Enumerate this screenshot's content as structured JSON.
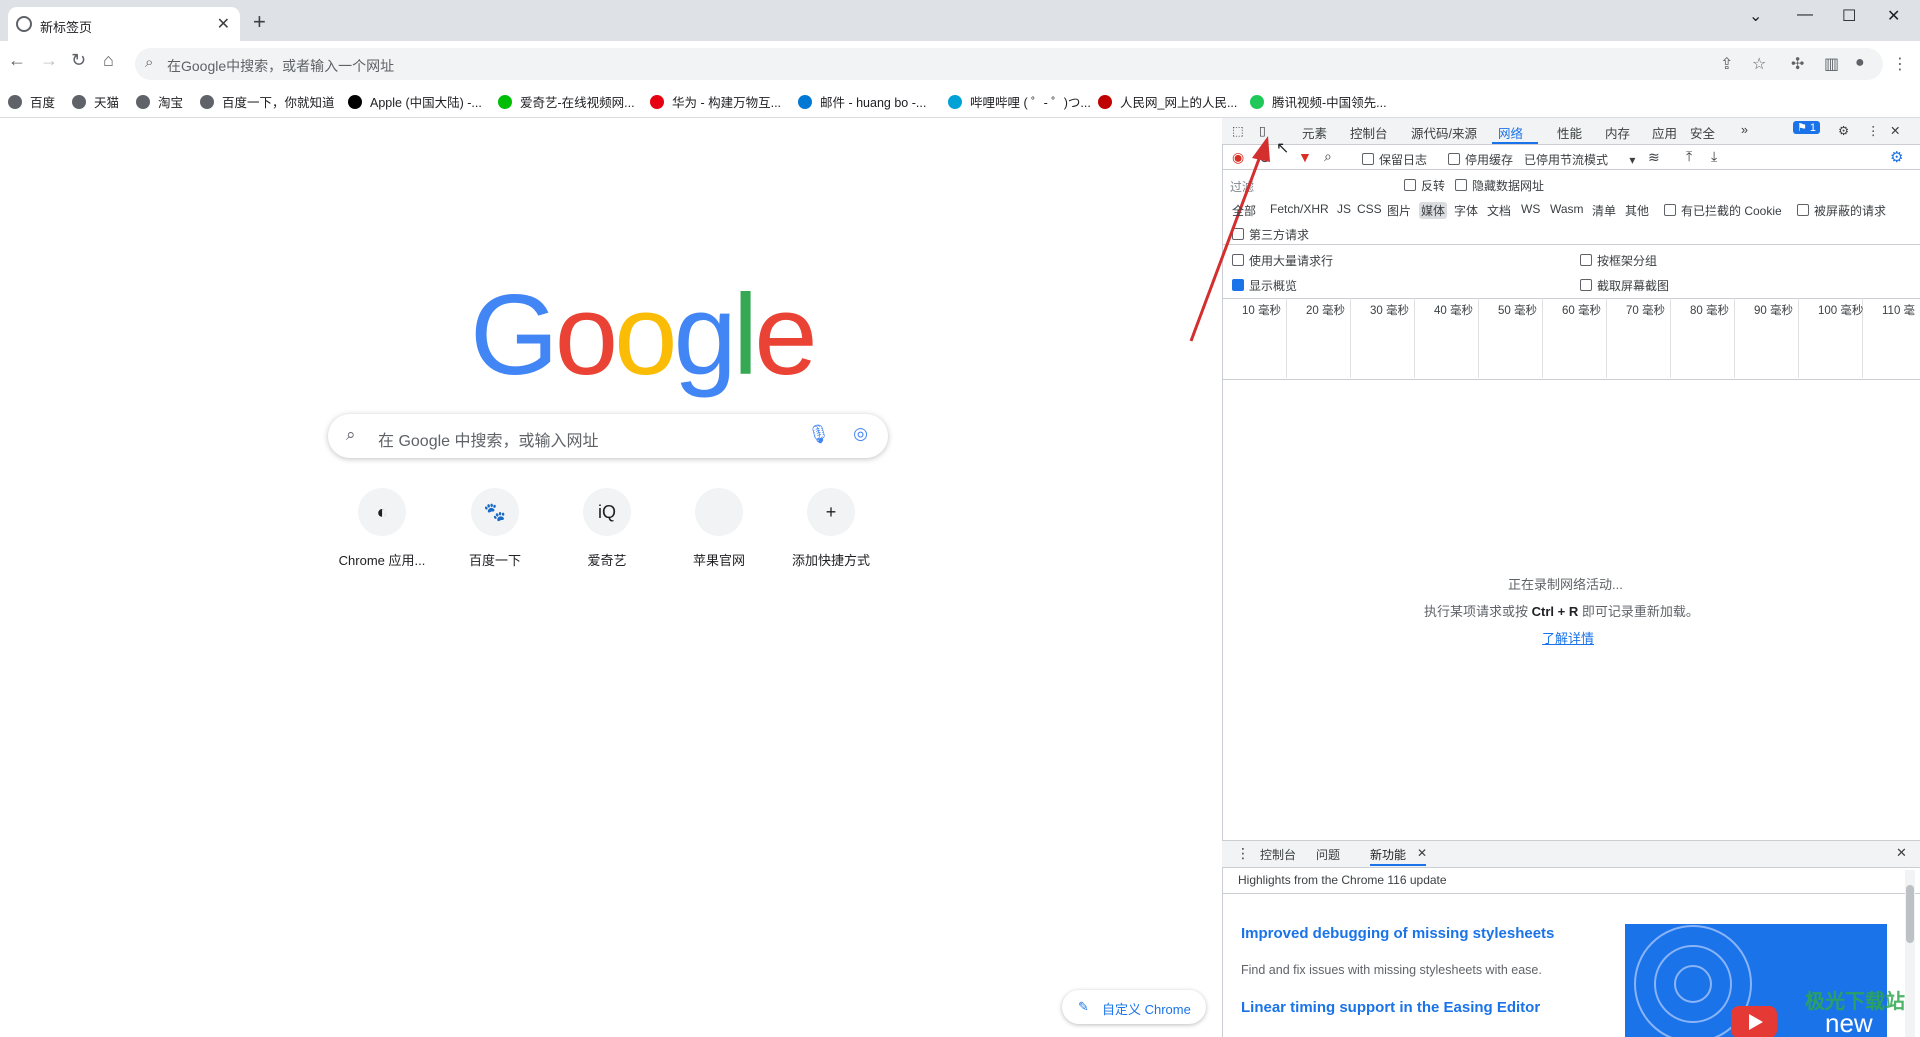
{
  "browser": {
    "tab_title": "新标签页",
    "tab_close": "✕",
    "new_tab": "+",
    "window_controls": [
      "⌄",
      "—",
      "☐",
      "✕"
    ],
    "omnibox_placeholder": "在Google中搜索，或者输入一个网址",
    "bookmarks": [
      {
        "label": "百度",
        "icon": "globe-icon",
        "color": "#5f6368"
      },
      {
        "label": "天猫",
        "icon": "globe-icon",
        "color": "#5f6368"
      },
      {
        "label": "淘宝",
        "icon": "globe-icon",
        "color": "#5f6368"
      },
      {
        "label": "百度一下，你就知道",
        "icon": "globe-icon",
        "color": "#5f6368"
      },
      {
        "label": "Apple (中国大陆) -...",
        "icon": "apple-icon",
        "color": "#000000"
      },
      {
        "label": "爱奇艺-在线视频网...",
        "icon": "iqiyi-icon",
        "color": "#00be06"
      },
      {
        "label": "华为 - 构建万物互...",
        "icon": "huawei-icon",
        "color": "#e60012"
      },
      {
        "label": "邮件 - huang bo -...",
        "icon": "outlook-icon",
        "color": "#0078d4"
      },
      {
        "label": "哔哩哔哩 ( ゜- ゜)つ...",
        "icon": "bilibili-icon",
        "color": "#00a1d6"
      },
      {
        "label": "人民网_网上的人民...",
        "icon": "people-icon",
        "color": "#c00000"
      },
      {
        "label": "腾讯视频-中国领先...",
        "icon": "tencent-video-icon",
        "color": "#20c85a"
      }
    ]
  },
  "newtab": {
    "logo": [
      "G",
      "o",
      "o",
      "g",
      "l",
      "e"
    ],
    "logo_colors": [
      "#4285f4",
      "#ea4335",
      "#fbbc05",
      "#4285f4",
      "#34a853",
      "#ea4335"
    ],
    "search_placeholder": "在 Google 中搜索，或输入网址",
    "shortcuts": [
      {
        "label": "Chrome 应用...",
        "icon": "chrome-webstore-icon"
      },
      {
        "label": "百度一下",
        "icon": "baidu-icon"
      },
      {
        "label": "爱奇艺",
        "icon": "iqiyi-icon"
      },
      {
        "label": "苹果官网",
        "icon": "apple-icon"
      },
      {
        "label": "添加快捷方式",
        "icon": "plus-icon"
      }
    ],
    "customize_label": "自定义 Chrome"
  },
  "devtools": {
    "tabs": [
      "元素",
      "控制台",
      "源代码/来源",
      "网络",
      "性能",
      "内存",
      "应用",
      "安全"
    ],
    "active_tab": "网络",
    "issues_badge": "1",
    "toolbar": {
      "preserve_log": "保留日志",
      "disable_cache": "停用缓存",
      "throttling": "已停用节流模式"
    },
    "filter": {
      "label": "过滤",
      "invert": "反转",
      "hide_data_urls": "隐藏数据网址"
    },
    "type_filters": [
      "全部",
      "Fetch/XHR",
      "JS",
      "CSS",
      "图片",
      "媒体",
      "字体",
      "文档",
      "WS",
      "Wasm",
      "清单",
      "其他"
    ],
    "active_type_filter": "媒体",
    "blocked_cookies": "有已拦截的 Cookie",
    "blocked_requests": "被屏蔽的请求",
    "third_party": "第三方请求",
    "options": {
      "big_request_rows": "使用大量请求行",
      "group_by_frame": "按框架分组",
      "show_overview": "显示概览",
      "capture_screenshots": "截取屏幕截图"
    },
    "show_overview_checked": true,
    "timeline_ticks": [
      "10 毫秒",
      "20 毫秒",
      "30 毫秒",
      "40 毫秒",
      "50 毫秒",
      "60 毫秒",
      "70 毫秒",
      "80 毫秒",
      "90 毫秒",
      "100 毫秒",
      "110 毫"
    ],
    "empty_state": {
      "line1": "正在录制网络活动...",
      "line2_pre": "执行某项请求或按 ",
      "line2_keys": "Ctrl + R",
      "line2_post": " 即可记录重新加载。",
      "learn_more": "了解详情"
    },
    "drawer": {
      "tabs": [
        "控制台",
        "问题",
        "新功能"
      ],
      "active_tab": "新功能",
      "highlights": "Highlights from the Chrome 116 update",
      "features": [
        {
          "title": "Improved debugging of missing stylesheets",
          "desc": "Find and fix issues with missing stylesheets with ease."
        },
        {
          "title": "Linear timing support in the Easing Editor",
          "desc": ""
        }
      ],
      "video_caption": "new"
    }
  },
  "watermark": "极光下载站"
}
